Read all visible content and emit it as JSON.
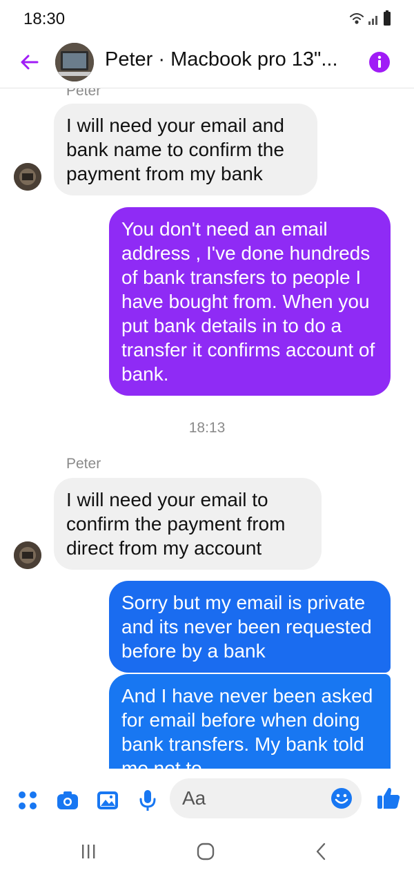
{
  "status_bar": {
    "time": "18:30"
  },
  "header": {
    "title": "Peter · Macbook pro 13\"..."
  },
  "messages": {
    "m0": {
      "sender": "Peter",
      "text": "I will need your email and bank name to confirm the payment from my bank"
    },
    "m1": {
      "text": "You don't need an email address , I've done hundreds of bank transfers to people I have bought from. When you put bank details in to do a transfer it confirms account of bank."
    },
    "time1": "18:13",
    "m2": {
      "sender": "Peter",
      "text": "I will need your email to confirm the payment from direct from my account"
    },
    "m3": {
      "text": "Sorry but my email is private and its never been requested before by a bank"
    },
    "m4": {
      "text": "And I have never been asked for email before when doing bank transfers. My bank told me not to"
    }
  },
  "composer": {
    "placeholder": "Aa"
  },
  "colors": {
    "accent": "#a01cf6",
    "purple_bubble": "#8f2bf5",
    "blue_bubble": "#1877f2",
    "gray_bubble": "#f0f0f0"
  },
  "icons": {
    "back": "arrow-left-icon",
    "info": "info-icon",
    "menu": "four-dots-icon",
    "camera": "camera-icon",
    "gallery": "image-icon",
    "mic": "microphone-icon",
    "emoji": "emoji-icon",
    "like": "thumbs-up-icon",
    "nav_recent": "recent-apps-icon",
    "nav_home": "home-icon",
    "nav_back": "back-chevron-icon"
  }
}
